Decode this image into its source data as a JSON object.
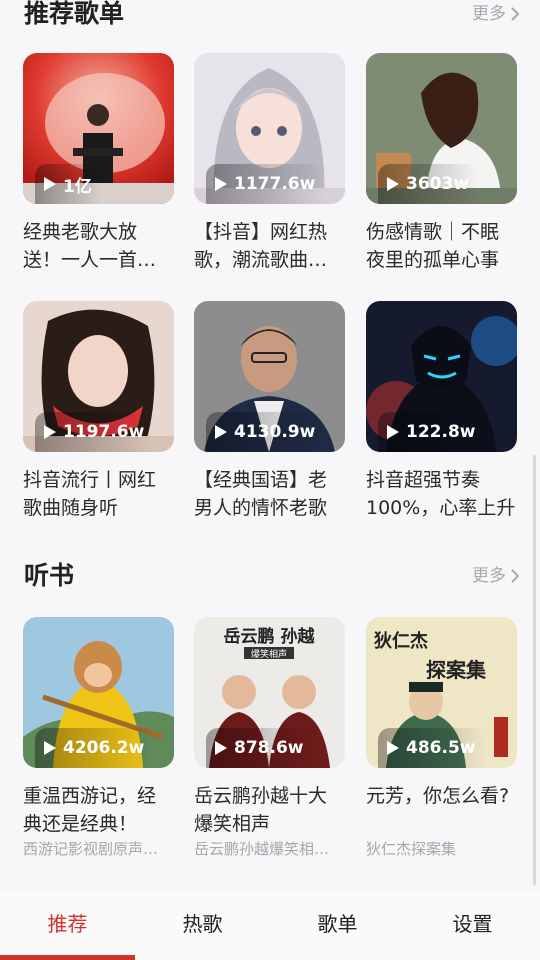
{
  "recommend": {
    "title": "推荐歌单",
    "more": "更多",
    "cards": [
      {
        "count": "1亿",
        "title": "经典老歌大放送！一人一首成名曲"
      },
      {
        "count": "1177.6w",
        "title": "【抖音】网红热歌，潮流歌曲在此"
      },
      {
        "count": "3603w",
        "title": "伤感情歌｜不眠夜里的孤单心事"
      },
      {
        "count": "1197.6w",
        "title": "抖音流行丨网红歌曲随身听"
      },
      {
        "count": "4130.9w",
        "title": "【经典国语】老男人的情怀老歌"
      },
      {
        "count": "122.8w",
        "title": "抖音超强节奏100%，心率上升"
      }
    ]
  },
  "audiobooks": {
    "title": "听书",
    "more": "更多",
    "cards": [
      {
        "count": "4206.2w",
        "title": "重温西游记，经典还是经典！",
        "sub": "西游记影视剧原声…"
      },
      {
        "count": "878.6w",
        "title": "岳云鹏孙越十大爆笑相声",
        "sub": "岳云鹏孙越爆笑相…"
      },
      {
        "count": "486.5w",
        "title": "元芳，你怎么看?",
        "sub": "狄仁杰探案集"
      }
    ],
    "cover_text": {
      "yue_title": "岳云鹏 孙越",
      "yue_sub": "爆笑相声",
      "di_title": "狄仁杰",
      "di_sub": "探案集"
    }
  },
  "nav": {
    "items": [
      "推荐",
      "热歌",
      "歌单",
      "设置"
    ],
    "active": 0
  },
  "colors": {
    "accent": "#d0322e",
    "background": "#f7f7f9"
  }
}
